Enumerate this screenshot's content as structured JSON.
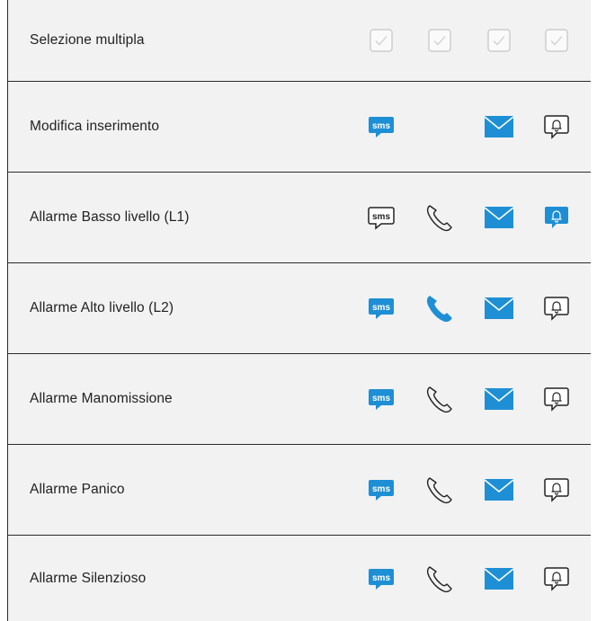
{
  "colors": {
    "accent": "#1e8fd5",
    "line": "#2b2b2b",
    "inactive": "#b9b9b9",
    "background": "#f2f2f2"
  },
  "rows": [
    {
      "label": "Selezione multipla",
      "icons": [
        "checkbox-icon",
        "checkbox-icon",
        "checkbox-icon",
        "checkbox-icon"
      ]
    },
    {
      "label": "Modifica inserimento",
      "icons": [
        "sms-icon-active",
        "none",
        "mail-icon-active",
        "bell-icon"
      ]
    },
    {
      "label": "Allarme Basso livello (L1)",
      "icons": [
        "sms-icon",
        "phone-icon",
        "mail-icon-active",
        "bell-icon-active"
      ]
    },
    {
      "label": "Allarme Alto livello (L2)",
      "icons": [
        "sms-icon-active",
        "phone-icon-active",
        "mail-icon-active",
        "bell-icon"
      ]
    },
    {
      "label": "Allarme Manomissione",
      "icons": [
        "sms-icon-active",
        "phone-icon",
        "mail-icon-active",
        "bell-icon"
      ]
    },
    {
      "label": "Allarme Panico",
      "icons": [
        "sms-icon-active",
        "phone-icon",
        "mail-icon-active",
        "bell-icon"
      ]
    },
    {
      "label": "Allarme Silenzioso",
      "icons": [
        "sms-icon-active",
        "phone-icon",
        "mail-icon-active",
        "bell-icon"
      ]
    }
  ],
  "sms_text": "sms"
}
